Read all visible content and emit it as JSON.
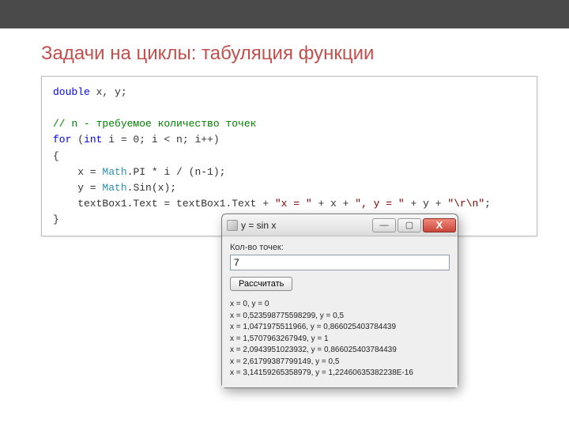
{
  "slide": {
    "title": "Задачи на циклы: табуляция функции"
  },
  "code": {
    "l1_kw": "double",
    "l1_rest": " x, y;",
    "l3_comment": "// n - требуемое количество точек",
    "l4_for": "for",
    "l4_a": " (",
    "l4_int": "int",
    "l4_b": " i = 0; i < n; i++)",
    "l5": "{",
    "l6_a": "    x = ",
    "l6_math": "Math",
    "l6_b": ".PI * i / (n-1);",
    "l7_a": "    y = ",
    "l7_math": "Math",
    "l7_b": ".Sin(x);",
    "l8_a": "    textBox1.Text = textBox1.Text + ",
    "l8_s1": "\"x = \"",
    "l8_b": " + x + ",
    "l8_s2": "\", y = \"",
    "l8_c": " + y + ",
    "l8_s3": "\"\\r\\n\"",
    "l8_d": ";",
    "l9": "}"
  },
  "window": {
    "title": "y = sin x",
    "label_points": "Кол-во точек:",
    "input_value": "7",
    "calc_button": "Рассчитать",
    "ctrl_min": "—",
    "ctrl_max": "▢",
    "ctrl_close": "X",
    "output_lines": [
      "x = 0, y = 0",
      "x = 0,523598775598299, y = 0,5",
      "x = 1,0471975511966, y = 0,866025403784439",
      "x = 1,5707963267949, y = 1",
      "x = 2,0943951023932, y = 0,866025403784439",
      "x = 2,61799387799149, y = 0,5",
      "x = 3,14159265358979, y = 1,22460635382238E-16"
    ]
  },
  "chart_data": {
    "type": "table",
    "title": "y = sin x",
    "n_points": 7,
    "columns": [
      "x",
      "y"
    ],
    "rows": [
      [
        0,
        0
      ],
      [
        0.523598775598299,
        0.5
      ],
      [
        1.0471975511966,
        0.866025403784439
      ],
      [
        1.5707963267949,
        1
      ],
      [
        2.0943951023932,
        0.866025403784439
      ],
      [
        2.61799387799149,
        0.5
      ],
      [
        3.14159265358979,
        1.22460635382238e-16
      ]
    ]
  }
}
